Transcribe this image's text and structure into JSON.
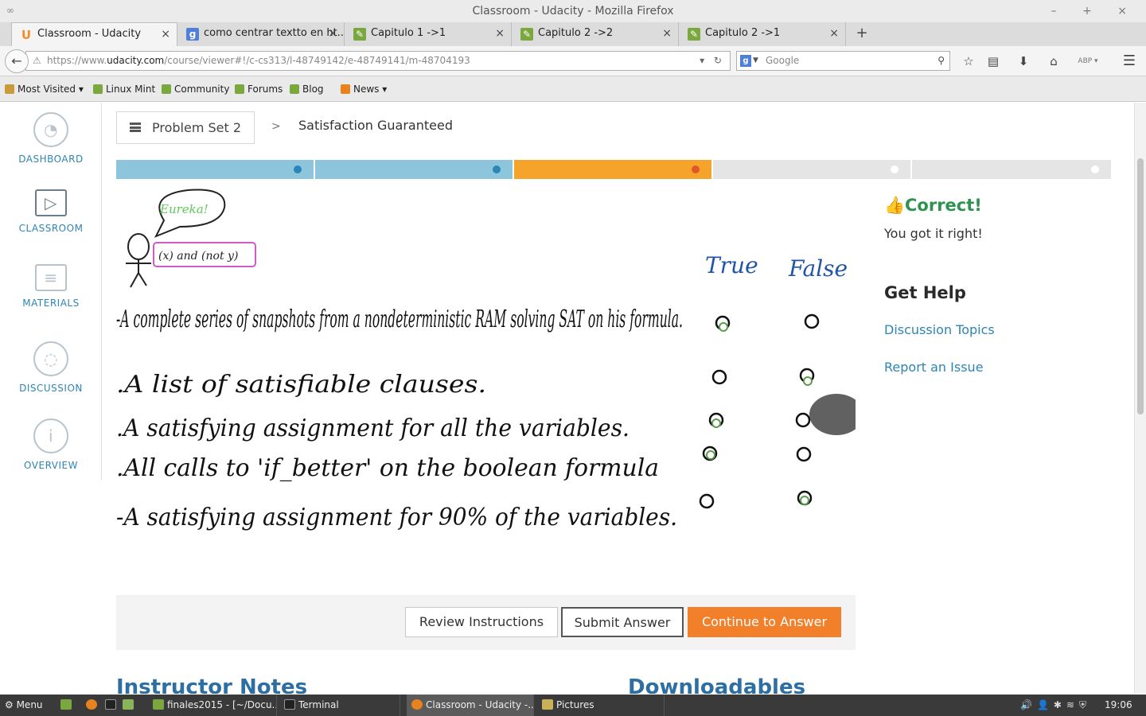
{
  "window": {
    "title": "Classroom - Udacity - Mozilla Firefox",
    "controls": "– + ×"
  },
  "tabs": [
    {
      "label": "Classroom - Udacity",
      "icon": "U",
      "icon_color": "#f28c28"
    },
    {
      "label": "como centrar textto en ht...",
      "icon": "g",
      "icon_color": "#4f7fd8"
    },
    {
      "label": "Capitulo 1 ->1",
      "icon": "E",
      "icon_color": "#7aa83f"
    },
    {
      "label": "Capitulo 2 ->2",
      "icon": "E",
      "icon_color": "#7aa83f"
    },
    {
      "label": "Capitulo 2 ->1",
      "icon": "E",
      "icon_color": "#7aa83f"
    }
  ],
  "nav": {
    "url_prefix": "https://www.",
    "url_domain": "udacity.com",
    "url_rest": "/course/viewer#!/c-cs313/l-48749142/e-48749141/m-48704193",
    "search_placeholder": "Google",
    "icons": [
      "bookmark-star-icon",
      "reading-list-icon",
      "download-icon",
      "home-icon",
      "adblock-icon",
      "menu-icon"
    ]
  },
  "bookmarks": [
    {
      "label": "Most Visited ▾",
      "color": "#c99b3c"
    },
    {
      "label": "Linux Mint",
      "color": "#7aa83f"
    },
    {
      "label": "Community",
      "color": "#7aa83f"
    },
    {
      "label": "Forums",
      "color": "#7aa83f"
    },
    {
      "label": "Blog",
      "color": "#7aa83f"
    },
    {
      "label": "News ▾",
      "color": "#e8821e"
    }
  ],
  "sidenav": [
    {
      "label": "DASHBOARD",
      "icon": "dashboard-gauge-icon",
      "glyph": "◔"
    },
    {
      "label": "CLASSROOM",
      "icon": "play-icon",
      "glyph": "▷"
    },
    {
      "label": "MATERIALS",
      "icon": "notebook-icon",
      "glyph": "≡"
    },
    {
      "label": "DISCUSSION",
      "icon": "chat-bubbles-icon",
      "glyph": "◌"
    },
    {
      "label": "OVERVIEW",
      "icon": "info-icon",
      "glyph": "i"
    }
  ],
  "breadcrumb": {
    "lesson": "Problem Set 2",
    "separator": ">",
    "current": "Satisfaction Guaranteed"
  },
  "progress": {
    "segments": [
      {
        "state": "complete",
        "color": "#8cc5dc",
        "dot": "#2b87b8"
      },
      {
        "state": "complete",
        "color": "#8cc5dc",
        "dot": "#2b87b8"
      },
      {
        "state": "current",
        "color": "#f5a32a",
        "dot": "#e0582a"
      },
      {
        "state": "upcoming",
        "color": "#e5e5e5",
        "dot": "#ffffff"
      },
      {
        "state": "upcoming",
        "color": "#e5e5e5",
        "dot": "#ffffff"
      }
    ]
  },
  "quiz": {
    "bubble": "Eureka!",
    "formula": "(x) and (not y)",
    "col_true": "True",
    "col_false": "False",
    "rows": [
      {
        "text": "-A complete series of snapshots from a nondeterministic RAM solving SAT on his formula.",
        "answer": "true"
      },
      {
        "text": ".A list of satisfiable clauses.",
        "answer": "false"
      },
      {
        "text": ".A satisfying assignment for all the variables.",
        "answer": "true"
      },
      {
        "text": ".All calls to 'if_better' on the boolean formula",
        "answer": "true"
      },
      {
        "text": "-A satisfying assignment for 90% of the variables.",
        "answer": "false"
      }
    ]
  },
  "controls": {
    "review": "Review Instructions",
    "submit": "Submit Answer",
    "continue": "Continue to Answer"
  },
  "feedback": {
    "title": "Correct!",
    "message": "You got it right!"
  },
  "help": {
    "title": "Get Help",
    "links": [
      "Discussion Topics",
      "Report an Issue"
    ]
  },
  "sections": {
    "notes": "Instructor Notes",
    "downloads": "Downloadables"
  },
  "taskbar": {
    "menu": "Menu",
    "windows": [
      "finales2015 - [~/Docu...",
      "Terminal",
      "Classroom - Udacity -...",
      "Pictures"
    ],
    "clock": "19:06"
  }
}
